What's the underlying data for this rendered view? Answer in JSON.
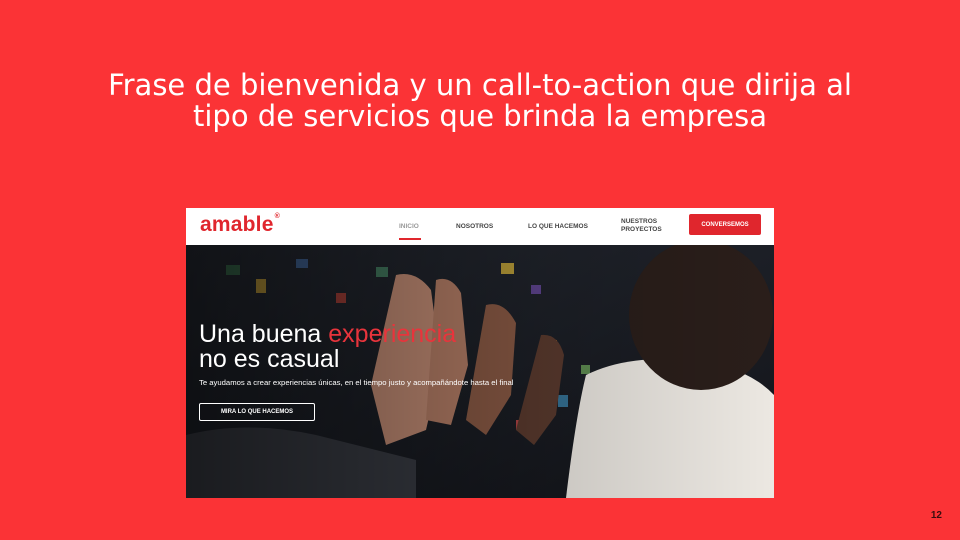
{
  "slide": {
    "title": "Frase de bienvenida y un call-to-action que dirija al tipo de servicios que brinda la empresa",
    "page_number": "12"
  },
  "website": {
    "logo": "amable",
    "logo_mark": "®",
    "nav": {
      "items": [
        {
          "label": "INICIO"
        },
        {
          "label": "NOSOTROS"
        },
        {
          "label": "LO QUE HACEMOS"
        },
        {
          "label": "NUESTROS PROYECTOS"
        }
      ],
      "active_item": "INICIO",
      "cta_label": "CONVERSEMOS"
    },
    "hero": {
      "headline_part1": "Una buena ",
      "headline_accent": "experiencia",
      "headline_line2": "no es casual",
      "subtext": "Te ayudamos a crear experiencias únicas, en el tiempo justo y acompañándote hasta el final",
      "button_label": "MIRA LO QUE HACEMOS",
      "image_icon": "people-high-five-photo"
    }
  },
  "colors": {
    "slide_background": "#fb3336",
    "brand_red": "#e0262d",
    "accent_text": "#e8343c",
    "hero_dark": "#1a1c22"
  }
}
